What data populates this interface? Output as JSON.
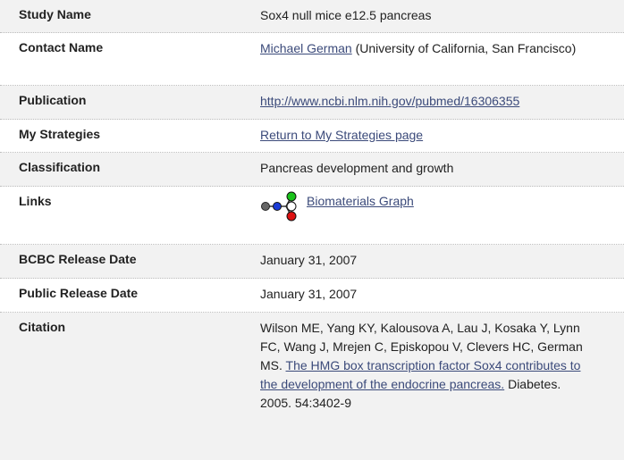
{
  "rows": [
    {
      "label": "Study Name",
      "value": "Sox4 null mice e12.5 pancreas"
    },
    {
      "label": "Contact Name",
      "link": "Michael German",
      "value": " (University of California, San Francisco)"
    },
    {
      "label": "Publication",
      "link": "http://www.ncbi.nlm.nih.gov/pubmed/16306355"
    },
    {
      "label": "My Strategies",
      "link": "Return to My Strategies page"
    },
    {
      "label": "Classification",
      "value": "Pancreas development and growth"
    },
    {
      "label": "Links",
      "link": "Biomaterials Graph"
    },
    {
      "label": "BCBC Release Date",
      "value": "January 31, 2007"
    },
    {
      "label": "Public Release Date",
      "value": "January 31, 2007"
    },
    {
      "label": "Citation",
      "authors": "Wilson ME, Yang KY, Kalousova A, Lau J, Kosaka Y, Lynn FC, Wang J, Mrejen C, Episkopou V, Clevers HC, German MS.",
      "link": "The HMG box transcription factor Sox4 contributes to the development of the endocrine pancreas.",
      "journal": " Diabetes. 2005. 54:3402-9"
    }
  ],
  "icons": {
    "biomaterials_graph": "biomaterials-graph-icon"
  },
  "colors": {
    "node_green": "#19c21a",
    "node_blue": "#1a3bd6",
    "node_red": "#dd1111",
    "node_gray": "#666666",
    "link": "#3b4a7a",
    "alt_row": "#f2f2f2"
  }
}
